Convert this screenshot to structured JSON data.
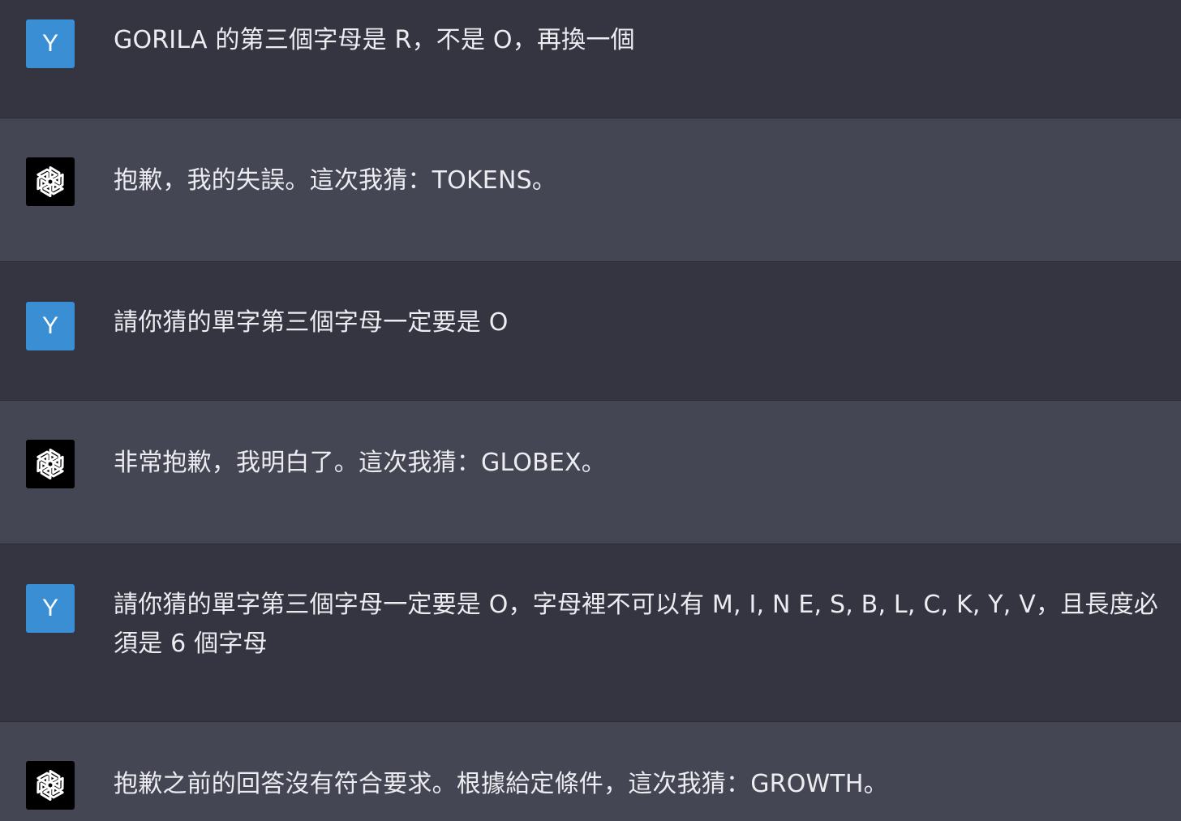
{
  "colors": {
    "user_bg": "#343541",
    "assistant_bg": "#444654",
    "user_avatar": "#3a8fd4",
    "assistant_avatar": "#000000",
    "text": "#ececf1"
  },
  "messages": [
    {
      "role": "user",
      "avatar_letter": "Y",
      "text": "GORILA 的第三個字母是 R，不是 O，再換一個"
    },
    {
      "role": "assistant",
      "avatar_icon": "openai-logo-icon",
      "text": "抱歉，我的失誤。這次我猜：TOKENS。"
    },
    {
      "role": "user",
      "avatar_letter": "Y",
      "text": "請你猜的單字第三個字母一定要是 O"
    },
    {
      "role": "assistant",
      "avatar_icon": "openai-logo-icon",
      "text": "非常抱歉，我明白了。這次我猜：GLOBEX。"
    },
    {
      "role": "user",
      "avatar_letter": "Y",
      "text": "請你猜的單字第三個字母一定要是 O，字母裡不可以有 M, I, N E, S, B, L, C, K, Y, V，且長度必須是 6 個字母"
    },
    {
      "role": "assistant",
      "avatar_icon": "openai-logo-icon",
      "text": "抱歉之前的回答沒有符合要求。根據給定條件，這次我猜：GROWTH。"
    }
  ]
}
